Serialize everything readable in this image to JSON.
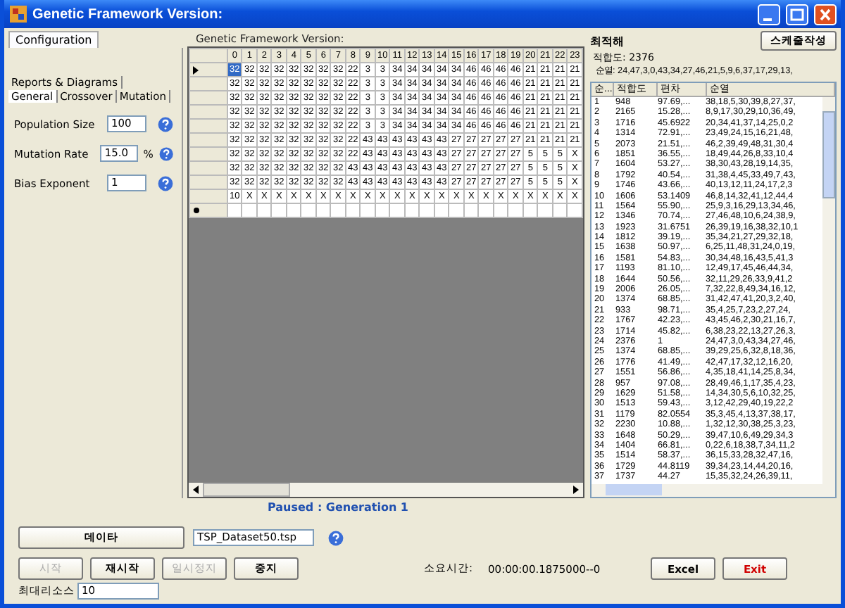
{
  "window": {
    "title": "Genetic Framework Version:"
  },
  "config": {
    "tabs": [
      {
        "label": "Configuration",
        "selected": true
      }
    ],
    "sub_tabs_top": [
      {
        "label": "Reports & Diagrams",
        "selected": false
      }
    ],
    "sub_tabs": [
      {
        "label": "General",
        "selected": true
      },
      {
        "label": "Crossover",
        "selected": false
      },
      {
        "label": "Mutation",
        "selected": false
      }
    ],
    "fields": [
      {
        "label": "Population Size",
        "value": "100"
      },
      {
        "label": "Mutation Rate",
        "value": "15.0",
        "unit": "%"
      },
      {
        "label": "Bias Exponent",
        "value": "1"
      }
    ]
  },
  "grid": {
    "title": "Genetic Framework Version:",
    "columns": [
      "0",
      "1",
      "2",
      "3",
      "4",
      "5",
      "6",
      "7",
      "8",
      "9",
      "10",
      "11",
      "12",
      "13",
      "14",
      "15",
      "16",
      "17",
      "18",
      "19",
      "20",
      "21",
      "22",
      "23"
    ],
    "rows": [
      {
        "selected": true,
        "cells": [
          "32",
          "32",
          "32",
          "32",
          "32",
          "32",
          "32",
          "32",
          "22",
          "3",
          "3",
          "34",
          "34",
          "34",
          "34",
          "34",
          "46",
          "46",
          "46",
          "46",
          "21",
          "21",
          "21",
          "21"
        ]
      },
      {
        "selected": false,
        "cells": [
          "32",
          "32",
          "32",
          "32",
          "32",
          "32",
          "32",
          "32",
          "22",
          "3",
          "3",
          "34",
          "34",
          "34",
          "34",
          "34",
          "46",
          "46",
          "46",
          "46",
          "21",
          "21",
          "21",
          "21"
        ]
      },
      {
        "selected": false,
        "cells": [
          "32",
          "32",
          "32",
          "32",
          "32",
          "32",
          "32",
          "32",
          "22",
          "3",
          "3",
          "34",
          "34",
          "34",
          "34",
          "34",
          "46",
          "46",
          "46",
          "46",
          "21",
          "21",
          "21",
          "21"
        ]
      },
      {
        "selected": false,
        "cells": [
          "32",
          "32",
          "32",
          "32",
          "32",
          "32",
          "32",
          "32",
          "22",
          "3",
          "3",
          "34",
          "34",
          "34",
          "34",
          "34",
          "46",
          "46",
          "46",
          "46",
          "21",
          "21",
          "21",
          "21"
        ]
      },
      {
        "selected": false,
        "cells": [
          "32",
          "32",
          "32",
          "32",
          "32",
          "32",
          "32",
          "32",
          "22",
          "3",
          "3",
          "34",
          "34",
          "34",
          "34",
          "34",
          "46",
          "46",
          "46",
          "46",
          "21",
          "21",
          "21",
          "21"
        ]
      },
      {
        "selected": false,
        "cells": [
          "32",
          "32",
          "32",
          "32",
          "32",
          "32",
          "32",
          "32",
          "22",
          "43",
          "43",
          "43",
          "43",
          "43",
          "43",
          "27",
          "27",
          "27",
          "27",
          "27",
          "21",
          "21",
          "21",
          "21"
        ]
      },
      {
        "selected": false,
        "cells": [
          "32",
          "32",
          "32",
          "32",
          "32",
          "32",
          "32",
          "32",
          "22",
          "43",
          "43",
          "43",
          "43",
          "43",
          "43",
          "27",
          "27",
          "27",
          "27",
          "27",
          "5",
          "5",
          "5",
          "X"
        ]
      },
      {
        "selected": false,
        "cells": [
          "32",
          "32",
          "32",
          "32",
          "32",
          "32",
          "32",
          "32",
          "43",
          "43",
          "43",
          "43",
          "43",
          "43",
          "43",
          "27",
          "27",
          "27",
          "27",
          "27",
          "5",
          "5",
          "5",
          "X"
        ]
      },
      {
        "selected": false,
        "cells": [
          "32",
          "32",
          "32",
          "32",
          "32",
          "32",
          "32",
          "32",
          "43",
          "43",
          "43",
          "43",
          "43",
          "43",
          "43",
          "27",
          "27",
          "27",
          "27",
          "27",
          "5",
          "5",
          "5",
          "X"
        ]
      },
      {
        "selected": false,
        "cells": [
          "10",
          "X",
          "X",
          "X",
          "X",
          "X",
          "X",
          "X",
          "X",
          "X",
          "X",
          "X",
          "X",
          "X",
          "X",
          "X",
          "X",
          "X",
          "X",
          "X",
          "X",
          "X",
          "X",
          "X"
        ]
      }
    ]
  },
  "best": {
    "title": "최적해",
    "button": "스케줄작성",
    "fitness": "적합도: 2376",
    "sequence": "순열: 24,47,3,0,43,34,27,46,21,5,9,6,37,17,29,13,"
  },
  "results": {
    "columns": [
      "순...",
      "적합도",
      "편차",
      "순열"
    ],
    "rows": [
      [
        "1",
        "948",
        "97.69,...",
        "38,18,5,30,39,8,27,37,"
      ],
      [
        "2",
        "2165",
        "15.28,...",
        "8,9,17,30,29,10,36,49,"
      ],
      [
        "3",
        "1716",
        "45.6922",
        "20,34,41,37,14,25,0,2"
      ],
      [
        "4",
        "1314",
        "72.91,...",
        "23,49,24,15,16,21,48,"
      ],
      [
        "5",
        "2073",
        "21.51,...",
        "46,2,39,49,48,31,30,4"
      ],
      [
        "6",
        "1851",
        "36.55,...",
        "18,49,44,26,8,33,10,4"
      ],
      [
        "7",
        "1604",
        "53.27,...",
        "38,30,43,28,19,14,35,"
      ],
      [
        "8",
        "1792",
        "40.54,...",
        "31,38,4,45,33,49,7,43,"
      ],
      [
        "9",
        "1746",
        "43.66,...",
        "40,13,12,11,24,17,2,3"
      ],
      [
        "10",
        "1606",
        "53.1409",
        "46,8,14,32,41,12,44,4"
      ],
      [
        "11",
        "1564",
        "55.90,...",
        "25,9,3,16,29,13,34,46,"
      ],
      [
        "12",
        "1346",
        "70.74,...",
        "27,46,48,10,6,24,38,9,"
      ],
      [
        "13",
        "1923",
        "31.6751",
        "26,39,19,16,38,32,10,1"
      ],
      [
        "14",
        "1812",
        "39.19,...",
        "35,34,21,27,29,32,18,"
      ],
      [
        "15",
        "1638",
        "50.97,...",
        "6,25,11,48,31,24,0,19,"
      ],
      [
        "16",
        "1581",
        "54.83,...",
        "30,34,48,16,43,5,41,3"
      ],
      [
        "17",
        "1193",
        "81.10,...",
        "12,49,17,45,46,44,34,"
      ],
      [
        "18",
        "1644",
        "50.56,...",
        "32,11,29,26,33,9,41,2"
      ],
      [
        "19",
        "2006",
        "26.05,...",
        "7,32,22,8,49,34,16,12,"
      ],
      [
        "20",
        "1374",
        "68.85,...",
        "31,42,47,41,20,3,2,40,"
      ],
      [
        "21",
        "933",
        "98.71,...",
        "35,4,25,7,23,2,27,24,"
      ],
      [
        "22",
        "1767",
        "42.23,...",
        "43,45,46,2,30,21,16,7,"
      ],
      [
        "23",
        "1714",
        "45.82,...",
        "6,38,23,22,13,27,26,3,"
      ],
      [
        "24",
        "2376",
        "1",
        "24,47,3,0,43,34,27,46,"
      ],
      [
        "25",
        "1374",
        "68.85,...",
        "39,29,25,6,32,8,18,36,"
      ],
      [
        "26",
        "1776",
        "41.49,...",
        "42,47,17,32,12,16,20,"
      ],
      [
        "27",
        "1551",
        "56.86,...",
        "4,35,18,41,14,25,8,34,"
      ],
      [
        "28",
        "957",
        "97.08,...",
        "28,49,46,1,17,35,4,23,"
      ],
      [
        "29",
        "1629",
        "51.58,...",
        "14,34,30,5,6,10,32,25,"
      ],
      [
        "30",
        "1513",
        "59.43,...",
        "3,12,42,29,40,19,22,2"
      ],
      [
        "31",
        "1179",
        "82.0554",
        "35,3,45,4,13,37,38,17,"
      ],
      [
        "32",
        "2230",
        "10.88,...",
        "1,32,12,30,38,25,3,23,"
      ],
      [
        "33",
        "1648",
        "50.29,...",
        "39,47,10,6,49,29,34,3"
      ],
      [
        "34",
        "1404",
        "66.81,...",
        "0,22,6,18,38,7,34,11,2"
      ],
      [
        "35",
        "1514",
        "58.37,...",
        "36,15,33,28,32,47,16,"
      ],
      [
        "36",
        "1729",
        "44.8119",
        "39,34,23,14,44,20,16,"
      ],
      [
        "37",
        "1737",
        "44.27",
        "15,35,32,24,26,39,11,"
      ]
    ]
  },
  "status": "Paused : Generation 1",
  "data_button": "데이타",
  "file_field": {
    "value": "TSP_Dataset50.tsp"
  },
  "controls": [
    {
      "label": "시작",
      "disabled": true
    },
    {
      "label": "재시작",
      "disabled": false
    },
    {
      "label": "일시정지",
      "disabled": true
    },
    {
      "label": "중지",
      "disabled": false
    }
  ],
  "elapsed": {
    "label": "소요시간:",
    "value": "00:00:00.1875000--0"
  },
  "excel_button": "Excel",
  "exit_button": "Exit",
  "max_resource": {
    "label": "최대리소스",
    "value": "10"
  }
}
